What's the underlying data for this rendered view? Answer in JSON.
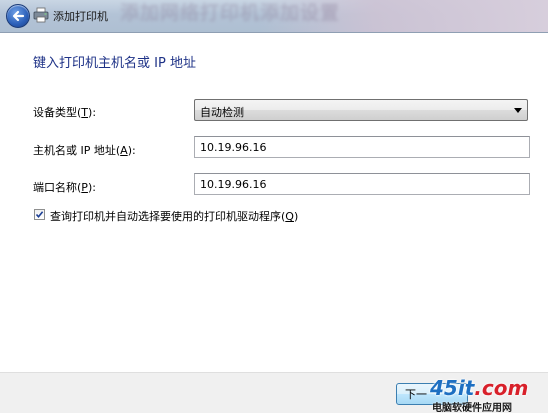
{
  "window": {
    "title": "添加打印机",
    "background_banner": "添加网络打印机添加设置"
  },
  "heading": "键入打印机主机名或 IP 地址",
  "device_type": {
    "label_prefix": "设备类型(",
    "label_key": "T",
    "label_suffix": "):",
    "selected": "自动检测"
  },
  "hostname": {
    "label_prefix": "主机名或 IP 地址(",
    "label_key": "A",
    "label_suffix": "):",
    "value": "10.19.96.16"
  },
  "port_name": {
    "label_prefix": "端口名称(",
    "label_key": "P",
    "label_suffix": "):",
    "value": "10.19.96.16"
  },
  "query_driver": {
    "label_prefix": "查询打印机并自动选择要使用的打印机驱动程序(",
    "label_key": "Q",
    "label_suffix": ")",
    "checked": true
  },
  "footer": {
    "next_label": "下一"
  },
  "watermark": {
    "logo_main": "45it",
    "logo_suffix": ".com",
    "subtitle": "电脑软硬件应用网"
  },
  "icons": {
    "back": "back-arrow-icon",
    "printer": "printer-icon",
    "dropdown": "chevron-down-icon",
    "check": "checkmark-icon"
  },
  "colors": {
    "heading": "#1e3287",
    "back_button": "#2b5fb8",
    "logo_blue": "#1d6fc2",
    "logo_red": "#d8202a"
  }
}
